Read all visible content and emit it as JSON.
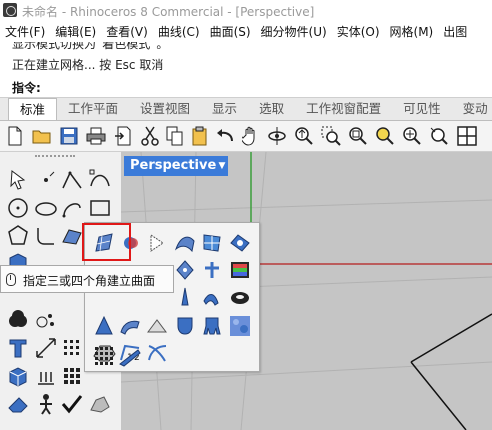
{
  "window": {
    "title": "未命名 - Rhinoceros 8 Commercial - [Perspective]"
  },
  "menu": [
    "文件(F)",
    "编辑(E)",
    "查看(V)",
    "曲线(C)",
    "曲面(S)",
    "细分物件(U)",
    "实体(O)",
    "网格(M)",
    "出图"
  ],
  "command_history": [
    "显示模式切换为“着色模式”。",
    "正在建立网格... 按 Esc 取消"
  ],
  "command_prompt": {
    "label": "指令:",
    "value": ""
  },
  "toolbar_tabs": [
    "标准",
    "工作平面",
    "设置视图",
    "显示",
    "选取",
    "工作视窗配置",
    "可见性",
    "变动"
  ],
  "active_tab": "标准",
  "standard_toolbar_icons": [
    "new-file-icon",
    "open-folder-icon",
    "save-icon",
    "print-icon",
    "import-icon",
    "cut-icon",
    "copy-icon",
    "paste-icon",
    "undo-icon",
    "pan-hand-icon",
    "rotate-view-icon",
    "zoom-dynamic-icon",
    "zoom-window-icon",
    "zoom-extents-icon",
    "zoom-selected-icon",
    "zoom-all-icon",
    "four-viewports-icon"
  ],
  "viewport": {
    "name": "Perspective"
  },
  "tooltip": {
    "text": "指定三或四个角建立曲面"
  },
  "colors": {
    "accent": "#3b7bd9",
    "highlight": "#e01818",
    "viewport_bg": "#c5c5c5",
    "grid_x_axis": "#b83a3a",
    "grid_y_axis": "#3a9e3a"
  }
}
